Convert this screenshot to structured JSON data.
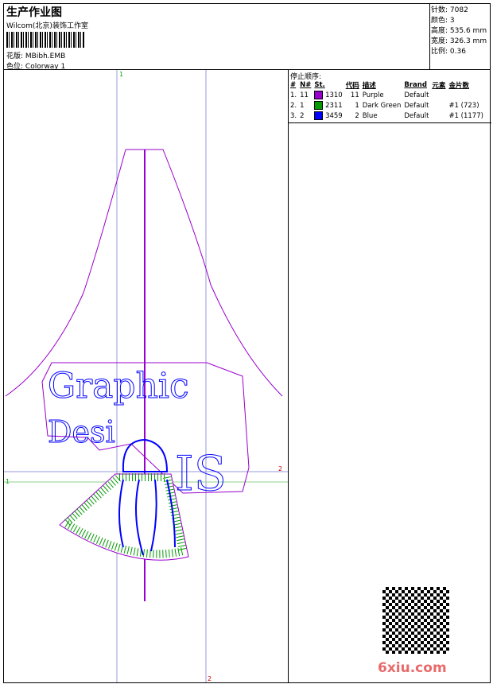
{
  "header": {
    "title": "生产作业图",
    "company": "Wilcom(北京)装饰工作室",
    "design_label": "花版:",
    "design_value": "MBibh.EMB",
    "colorway_label": "色位:",
    "colorway_value": "Colorway 1"
  },
  "stats": [
    {
      "label": "针数:",
      "value": "7082"
    },
    {
      "label": "颜色:",
      "value": "3"
    },
    {
      "label": "高度:",
      "value": "535.6 mm"
    },
    {
      "label": "宽度:",
      "value": "326.3 mm"
    },
    {
      "label": "比例:",
      "value": "0.36"
    }
  ],
  "sequence": {
    "title": "停止顺序:",
    "columns": [
      "#",
      "N#",
      "St.",
      "代码",
      "描述",
      "Brand",
      "元素",
      "金片数"
    ],
    "rows": [
      {
        "idx": "1.",
        "n": "11",
        "color": "#9900cc",
        "st": "1310",
        "code": "11",
        "desc": "Purple",
        "brand": "Default",
        "elem": "",
        "seq": ""
      },
      {
        "idx": "2.",
        "n": "1",
        "color": "#009900",
        "st": "2311",
        "code": "1",
        "desc": "Dark Green",
        "brand": "Default",
        "elem": "",
        "seq": "#1 (723)"
      },
      {
        "idx": "3.",
        "n": "2",
        "color": "#0000ff",
        "st": "3459",
        "code": "2",
        "desc": "Blue",
        "brand": "Default",
        "elem": "",
        "seq": "#1 (1177)"
      }
    ]
  },
  "design": {
    "text1": "Graphic",
    "text2": "Desi",
    "text3": "IS",
    "marker1": "1",
    "marker2": "2"
  },
  "watermark": "6xiu.com"
}
